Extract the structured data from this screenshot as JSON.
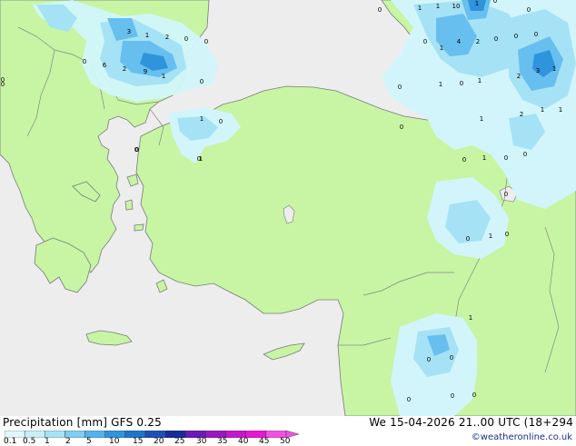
{
  "title": "Precipitation [mm]  GFS 0.25",
  "datetime": "We 15-04-2026 21..00 UTC (18+294",
  "credit": "©weatheronline.co.uk",
  "legend": {
    "ticks": [
      "0.1",
      "0.5",
      "1",
      "2",
      "5",
      "10",
      "15",
      "20",
      "25",
      "30",
      "35",
      "40",
      "45",
      "50"
    ],
    "colors": [
      "#e0f7fb",
      "#c8eef8",
      "#a6e2f6",
      "#7fcdf1",
      "#53b3ea",
      "#2f94dc",
      "#1f74cc",
      "#1d4fb6",
      "#1a2a9a",
      "#6a1ab5",
      "#9a18c2",
      "#c317c9",
      "#e41ad0",
      "#f052e4"
    ]
  },
  "palette": {
    "sea": "#ededed",
    "land": "#c7f5a4",
    "border": "#868686",
    "precip_light": "#d2f5fb",
    "precip_mid": "#a6e2f6",
    "precip_heavy": "#66bfee",
    "precip_max": "#2f94dc"
  },
  "labels": [
    {
      "t": "0"
    },
    {
      "t": "1"
    },
    {
      "t": "1"
    },
    {
      "t": "10"
    },
    {
      "t": "1"
    },
    {
      "t": "0"
    },
    {
      "t": "0"
    },
    {
      "t": "3"
    },
    {
      "t": "1"
    },
    {
      "t": "2"
    },
    {
      "t": "0"
    },
    {
      "t": "0"
    },
    {
      "t": "0"
    },
    {
      "t": "6"
    },
    {
      "t": "2"
    },
    {
      "t": "9"
    },
    {
      "t": "1"
    },
    {
      "t": "0"
    },
    {
      "t": "0"
    },
    {
      "t": "1"
    },
    {
      "t": "4"
    },
    {
      "t": "2"
    },
    {
      "t": "0"
    },
    {
      "t": "0"
    },
    {
      "t": "0"
    },
    {
      "t": "2"
    },
    {
      "t": "3"
    },
    {
      "t": "1"
    },
    {
      "t": "0"
    },
    {
      "t": "1"
    },
    {
      "t": "0"
    },
    {
      "t": "1"
    },
    {
      "t": "2"
    },
    {
      "t": "1"
    },
    {
      "t": "1"
    },
    {
      "t": "1"
    },
    {
      "t": "0"
    },
    {
      "t": "0"
    },
    {
      "t": "1"
    },
    {
      "t": "0"
    },
    {
      "t": "1"
    },
    {
      "t": "0"
    },
    {
      "t": "0"
    },
    {
      "t": "0"
    },
    {
      "t": "0"
    },
    {
      "t": "1"
    },
    {
      "t": "1"
    },
    {
      "t": "0"
    },
    {
      "t": "0"
    },
    {
      "t": "0"
    },
    {
      "t": "0"
    },
    {
      "t": "0"
    },
    {
      "t": "0"
    },
    {
      "t": "0"
    },
    {
      "t": "0"
    },
    {
      "t": "0"
    },
    {
      "t": "0"
    },
    {
      "t": "1"
    },
    {
      "t": "0"
    }
  ]
}
